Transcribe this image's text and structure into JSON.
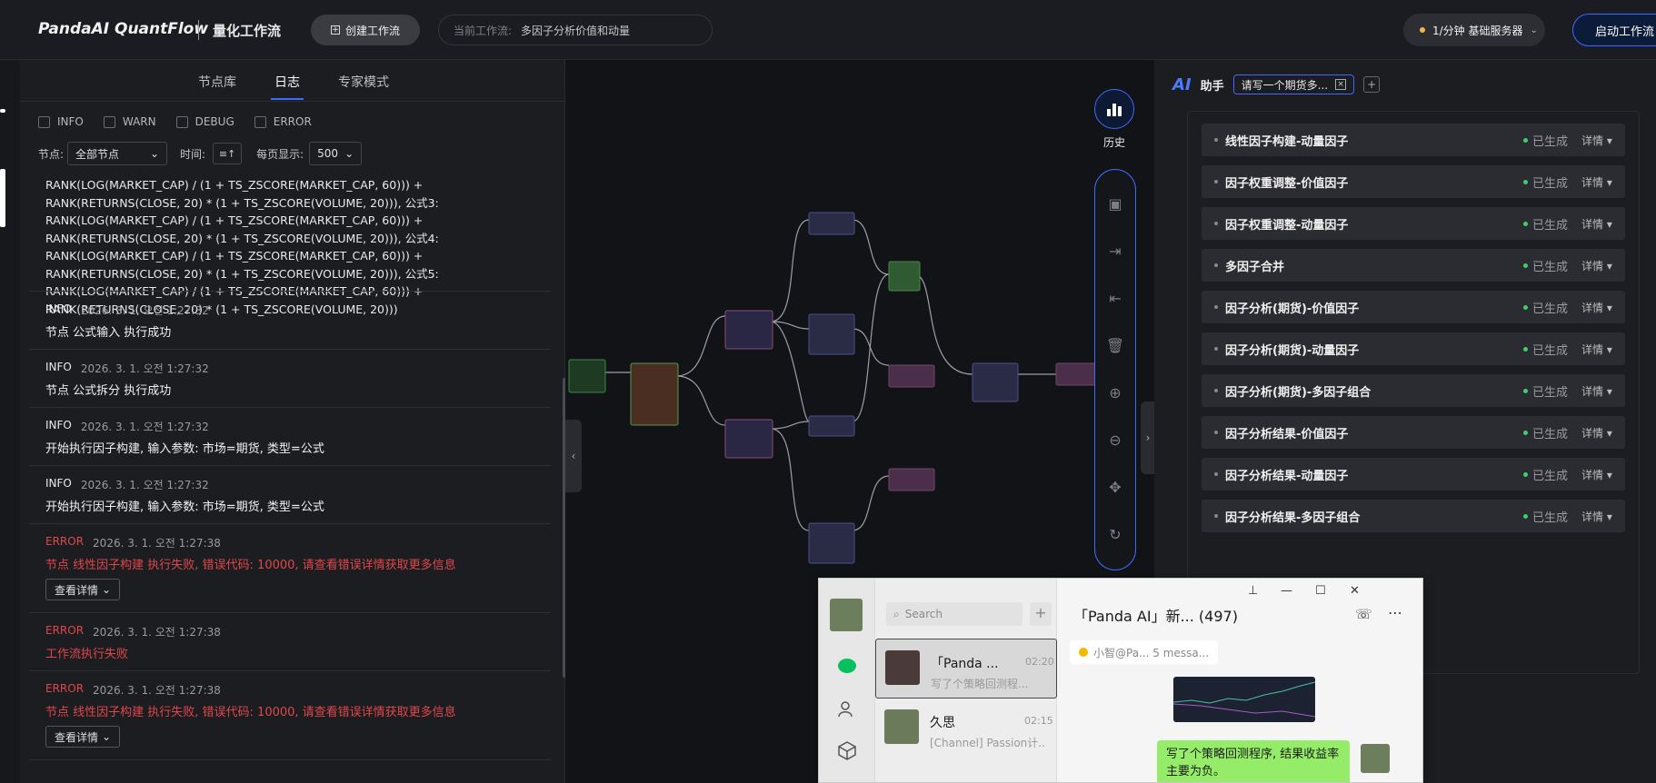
{
  "header": {
    "brand": "PandaAI QuantFlow",
    "subtitle": "量化工作流",
    "create_label": "创建工作流",
    "current_label": "当前工作流:",
    "current_value": "多因子分析价值和动量",
    "server_label": "1/分钟  基础服务器",
    "launch_label": "启动工作流"
  },
  "left_panel": {
    "tabs": [
      "节点库",
      "日志",
      "专家模式"
    ],
    "active_tab": "日志",
    "filters": [
      "INFO",
      "WARN",
      "DEBUG",
      "ERROR"
    ],
    "node_label": "节点:",
    "node_value": "全部节点",
    "time_label": "时间:",
    "page_label": "每页显示:",
    "page_value": "500",
    "log_text": "RANK(LOG(MARKET_CAP) / (1 + TS_ZSCORE(MARKET_CAP, 60))) + RANK(RETURNS(CLOSE, 20) * (1 + TS_ZSCORE(VOLUME, 20))), 公式3: RANK(LOG(MARKET_CAP) / (1 + TS_ZSCORE(MARKET_CAP, 60))) + RANK(RETURNS(CLOSE, 20) * (1 + TS_ZSCORE(VOLUME, 20))), 公式4: RANK(LOG(MARKET_CAP) / (1 + TS_ZSCORE(MARKET_CAP, 60))) + RANK(RETURNS(CLOSE, 20) * (1 + TS_ZSCORE(VOLUME, 20))), 公式5: RANK(LOG(MARKET_CAP) / (1 + TS_ZSCORE(MARKET_CAP, 60))) + RANK(RETURNS(CLOSE, 20) * (1 + TS_ZSCORE(VOLUME, 20)))",
    "entries": [
      {
        "level": "INFO",
        "time": "2026. 3. 1. 오전 1:27:32",
        "msg": "节点 公式输入 执行成功"
      },
      {
        "level": "INFO",
        "time": "2026. 3. 1. 오전 1:27:32",
        "msg": "节点 公式拆分 执行成功"
      },
      {
        "level": "INFO",
        "time": "2026. 3. 1. 오전 1:27:32",
        "msg": "开始执行因子构建, 输入参数: 市场=期货, 类型=公式"
      },
      {
        "level": "INFO",
        "time": "2026. 3. 1. 오전 1:27:32",
        "msg": "开始执行因子构建, 输入参数: 市场=期货, 类型=公式"
      },
      {
        "level": "ERROR",
        "time": "2026. 3. 1. 오전 1:27:38",
        "msg": "节点 线性因子构建 执行失败, 错误代码: 10000, 请查看错误详情获取更多信息"
      },
      {
        "level": "ERROR",
        "time": "2026. 3. 1. 오전 1:27:38",
        "msg": "工作流执行失败"
      },
      {
        "level": "ERROR",
        "time": "2026. 3. 1. 오전 1:27:38",
        "msg": "节点 线性因子构建 执行失败, 错误代码: 10000, 请查看错误详情获取更多信息"
      }
    ],
    "detail_label": "查看详情"
  },
  "toolbar": {
    "history_label": "历史"
  },
  "assistant": {
    "logo": "AI",
    "title": "助手",
    "tab_label": "请写一个期货多...",
    "steps": [
      "线性因子构建-动量因子",
      "因子权重调整-价值因子",
      "因子权重调整-动量因子",
      "多因子合并",
      "因子分析(期货)-价值因子",
      "因子分析(期货)-动量因子",
      "因子分析(期货)-多因子组合",
      "因子分析结果-价值因子",
      "因子分析结果-动量因子",
      "因子分析结果-多因子组合"
    ],
    "status_label": "已生成",
    "detail_label": "详情 ▾"
  },
  "chat": {
    "search_placeholder": "Search",
    "conversations": [
      {
        "name": "「Panda ...",
        "time": "02:20",
        "preview": "写了个策略回测程..."
      },
      {
        "name": "久思",
        "time": "02:15",
        "preview": "[Channel] Passion计..."
      }
    ],
    "title": "「Panda AI」新... (497)",
    "notice": "小智@Pa...   5 messa...",
    "bubble": "写了个策略回测程序, 结果收益率主要为负。"
  },
  "colors": {
    "accent": "#3d6bff",
    "error": "#e0474a",
    "success": "#3fcf6a"
  }
}
